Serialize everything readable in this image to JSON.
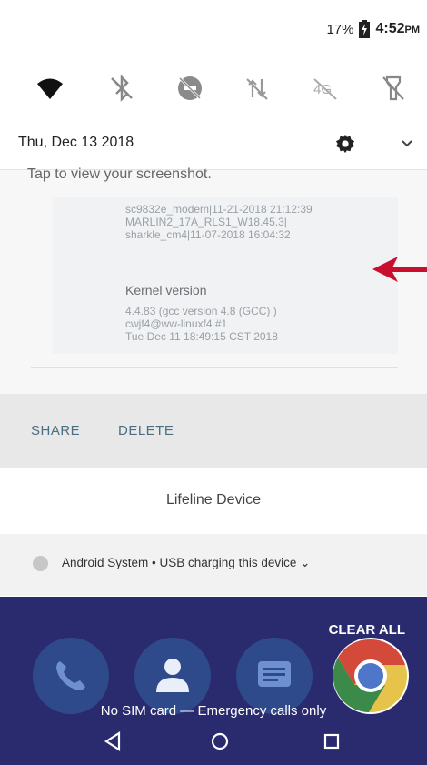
{
  "status_bar": {
    "battery": "17%",
    "time": "4:52",
    "ampm": "PM"
  },
  "quick_settings": [
    "wifi-icon",
    "bluetooth-off-icon",
    "do-not-disturb-off-icon",
    "data-off-icon",
    "4g-off-icon",
    "flashlight-off-icon"
  ],
  "header": {
    "date": "Thu, Dec 13 2018"
  },
  "screenshot_notification": {
    "text": "Tap to view your screenshot.",
    "preview_lines": [
      "sc9832e_modem|11-21-2018 21:12:39",
      "MARLIN2_17A_RLS1_W18.45.3|",
      "sharkle_cm4|11-07-2018 16:04:32"
    ],
    "preview_heading": "Kernel version",
    "preview_kernel": [
      "4.4.83 (gcc version 4.8 (GCC) )",
      "cwjf4@ww-linuxf4 #1",
      "Tue Dec 11 18:49:15 CST 2018"
    ],
    "share_label": "SHARE",
    "delete_label": "DELETE"
  },
  "lifeline_notification": {
    "text": "Lifeline Device"
  },
  "system_notification": {
    "text": "Android System • USB charging this device ⌄"
  },
  "recents": {
    "clear_all": "CLEAR ALL",
    "apps": [
      "phone-icon",
      "contacts-icon",
      "messages-icon",
      "chrome-icon"
    ],
    "no_sim": "No SIM card — Emergency calls only"
  },
  "nav": [
    "back-icon",
    "home-icon",
    "recents-icon"
  ],
  "colors": {
    "recents_bg": "#2a2a6e",
    "action_text": "#4a6f83",
    "arrow": "#c8102e"
  }
}
